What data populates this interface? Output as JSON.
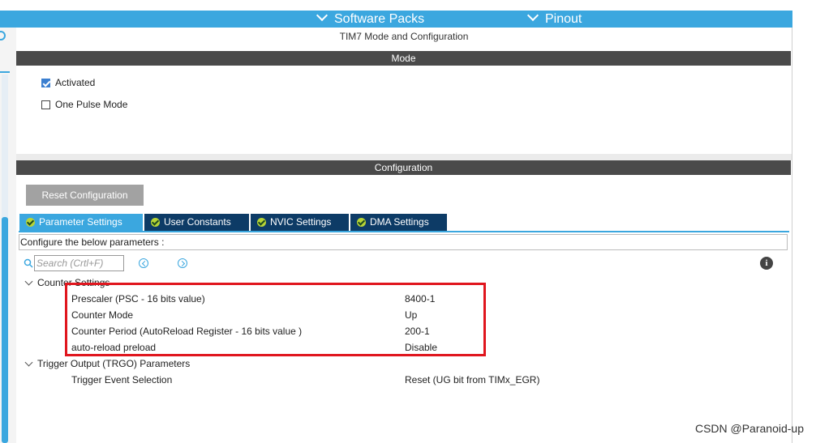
{
  "topbar": {
    "software_packs": "Software Packs",
    "pinout": "Pinout"
  },
  "panel_title": "TIM7 Mode and Configuration",
  "mode": {
    "header": "Mode",
    "options": [
      {
        "label": "Activated",
        "checked": true
      },
      {
        "label": "One Pulse Mode",
        "checked": false
      }
    ]
  },
  "configuration": {
    "header": "Configuration",
    "reset_button": "Reset Configuration",
    "tabs": [
      {
        "label": "Parameter Settings",
        "active": true
      },
      {
        "label": "User Constants",
        "active": false
      },
      {
        "label": "NVIC Settings",
        "active": false
      },
      {
        "label": "DMA Settings",
        "active": false
      }
    ],
    "hint": "Configure the below parameters :",
    "search_placeholder": "Search (Crtl+F)",
    "groups": [
      {
        "name": "Counter Settings",
        "params": [
          {
            "name": "Prescaler (PSC - 16 bits value)",
            "value": "8400-1"
          },
          {
            "name": "Counter Mode",
            "value": "Up"
          },
          {
            "name": "Counter Period (AutoReload Register - 16 bits value )",
            "value": "200-1"
          },
          {
            "name": "auto-reload preload",
            "value": "Disable"
          }
        ]
      },
      {
        "name": "Trigger Output (TRGO) Parameters",
        "params": [
          {
            "name": "Trigger Event Selection",
            "value": "Reset (UG bit from TIMx_EGR)"
          }
        ]
      }
    ]
  },
  "info_icon": "i",
  "watermark": "CSDN @Paranoid-up",
  "colors": {
    "accent": "#3ba7df",
    "tab_inactive": "#0d3b66",
    "header_bar": "#4a4a4a",
    "highlight": "#e0161e"
  }
}
